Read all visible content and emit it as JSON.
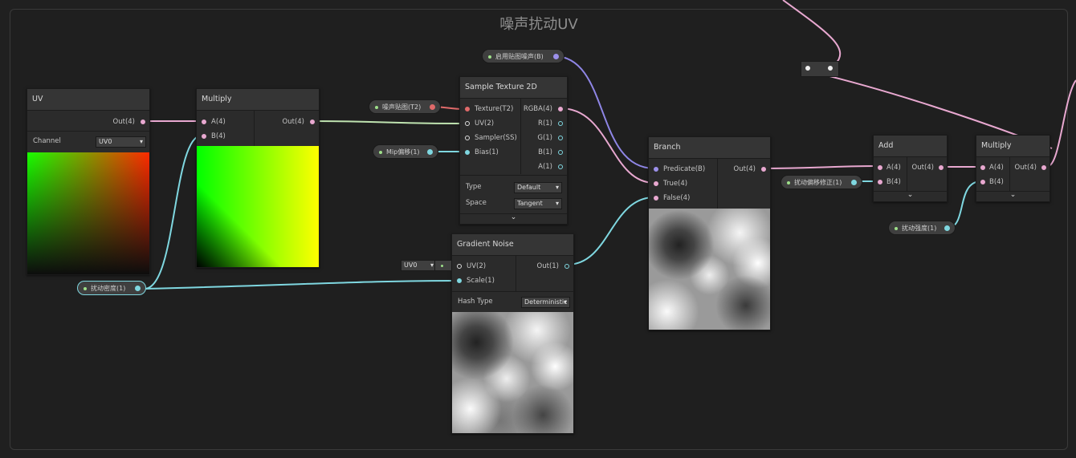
{
  "group": {
    "title": "噪声扰动UV"
  },
  "uv_node": {
    "title": "UV",
    "out_label": "Out(4)",
    "channel_label": "Channel",
    "channel_value": "UV0"
  },
  "multiply_node": {
    "title": "Multiply",
    "a_label": "A(4)",
    "b_label": "B(4)",
    "out_label": "Out(4)"
  },
  "sample_node": {
    "title": "Sample Texture 2D",
    "inputs": [
      "Texture(T2)",
      "UV(2)",
      "Sampler(SS)",
      "Bias(1)"
    ],
    "outputs": [
      "RGBA(4)",
      "R(1)",
      "G(1)",
      "B(1)",
      "A(1)"
    ],
    "type_label": "Type",
    "type_value": "Default",
    "space_label": "Space",
    "space_value": "Tangent"
  },
  "gradient_node": {
    "title": "Gradient Noise",
    "uv_label": "UV(2)",
    "scale_label": "Scale(1)",
    "out_label": "Out(1)",
    "uv_default": "UV0",
    "hash_label": "Hash Type",
    "hash_value": "Deterministic"
  },
  "branch_node": {
    "title": "Branch",
    "inputs": [
      "Predicate(B)",
      "True(4)",
      "False(4)"
    ],
    "out_label": "Out(4)"
  },
  "add_node": {
    "title": "Add",
    "a_label": "A(4)",
    "b_label": "B(4)",
    "out_label": "Out(4)"
  },
  "multiply2_node": {
    "title": "Multiply",
    "a_label": "A(4)",
    "b_label": "B(4)",
    "out_label": "Out(4)"
  },
  "properties": {
    "noise_tex": "噪声贴图(T2)",
    "mip": "Mip偏移(1)",
    "use_tex": "启用贴图噪声(B)",
    "density": "扰动密度(1)",
    "offset_fix": "扰动偏移修正(1)",
    "strength": "扰动强度(1)"
  },
  "colors": {
    "wire_pink": "#e8a8d0",
    "wire_cyan": "#7fd7e0",
    "wire_green": "#9ee08a",
    "wire_purple": "#8f86e6"
  }
}
